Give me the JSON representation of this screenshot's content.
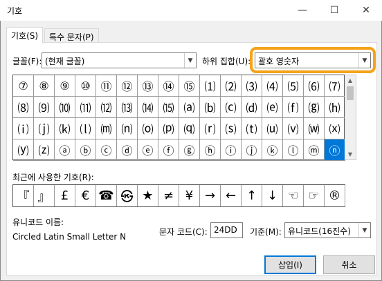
{
  "window": {
    "title": "기호",
    "minimize_glyph": "—",
    "maximize_glyph": "☐",
    "close_glyph": "✕"
  },
  "tabs": [
    {
      "label": "기호(S)"
    },
    {
      "label": "특수 문자(P)"
    }
  ],
  "font": {
    "label": "글꼴(F):",
    "value": "(현재 글꼴)"
  },
  "subset": {
    "label": "하위 집합(U):",
    "value": "괄호 영숫자"
  },
  "symbols": [
    [
      "⑦",
      "⑧",
      "⑨",
      "⑩",
      "⑪",
      "⑫",
      "⑬",
      "⑭",
      "⑮",
      "⑴",
      "⑵",
      "⑶",
      "⑷",
      "⑸",
      "⑹",
      "⑺"
    ],
    [
      "⑻",
      "⑼",
      "⑽",
      "⑾",
      "⑿",
      "⒀",
      "⒁",
      "⒂",
      "⒜",
      "⒝",
      "⒞",
      "⒟",
      "⒠",
      "⒡",
      "⒢",
      "⒣"
    ],
    [
      "⒤",
      "⒥",
      "⒦",
      "⒧",
      "⒨",
      "⒩",
      "⒪",
      "⒫",
      "⒬",
      "⒭",
      "⒮",
      "⒯",
      "⒰",
      "⒱",
      "⒲",
      "⒳"
    ],
    [
      "⒴",
      "⒵",
      "ⓐ",
      "ⓑ",
      "ⓒ",
      "ⓓ",
      "ⓔ",
      "ⓕ",
      "ⓖ",
      "ⓗ",
      "ⓘ",
      "ⓙ",
      "ⓚ",
      "ⓛ",
      "ⓜ",
      "ⓝ"
    ]
  ],
  "recent": {
    "label": "최근에 사용한 기호(R):",
    "items": [
      "『",
      "』",
      "£",
      "€",
      "☎",
      "㉿",
      "★",
      "≠",
      "¥",
      "→",
      "←",
      "↑",
      "↓",
      "☜",
      "☞",
      "®"
    ]
  },
  "unicode_name": {
    "label": "유니코드 이름:",
    "value": "Circled Latin Small Letter N"
  },
  "char_code": {
    "label": "문자 코드(C):",
    "value": "24DD"
  },
  "from": {
    "label": "기준(M):",
    "value": "유니코드(16진수)"
  },
  "buttons": {
    "insert": "삽입(I)",
    "cancel": "취소"
  },
  "colors": {
    "accent": "#0078d7",
    "highlight": "#f5a31a"
  }
}
